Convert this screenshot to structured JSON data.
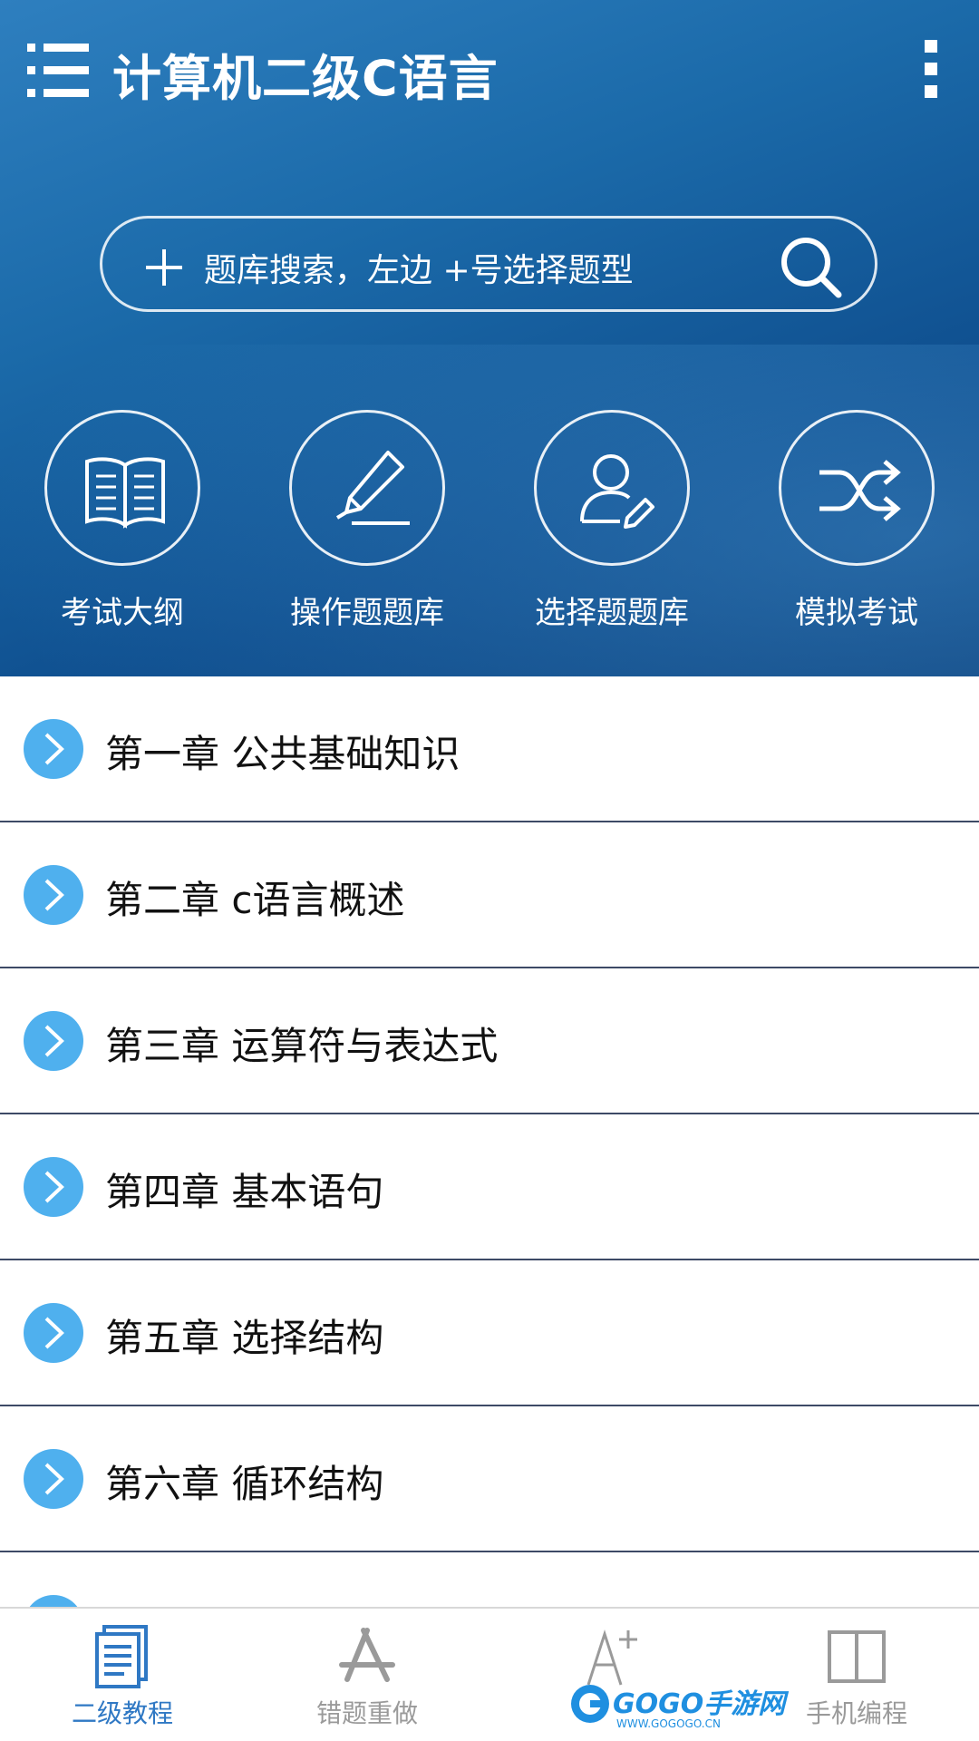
{
  "header": {
    "title": "计算机二级C语言",
    "menu_icon": "list-menu-icon",
    "more_icon": "more-vertical-icon"
  },
  "search": {
    "placeholder": "题库搜索，左边 +号选择题型",
    "plus_icon": "plus-icon",
    "search_icon": "search-icon"
  },
  "quick_actions": [
    {
      "label": "考试大纲",
      "icon": "book-icon"
    },
    {
      "label": "操作题题库",
      "icon": "pen-icon"
    },
    {
      "label": "选择题题库",
      "icon": "user-edit-icon"
    },
    {
      "label": "模拟考试",
      "icon": "shuffle-icon"
    }
  ],
  "chapters": [
    {
      "label": "第一章 公共基础知识"
    },
    {
      "label": "第二章  c语言概述"
    },
    {
      "label": "第三章  运算符与表达式"
    },
    {
      "label": "第四章  基本语句"
    },
    {
      "label": "第五章  选择结构"
    },
    {
      "label": "第六章  循环结构"
    }
  ],
  "bottom_nav": [
    {
      "label": "二级教程",
      "icon": "document-icon",
      "active": true
    },
    {
      "label": "错题重做",
      "icon": "app-store-icon",
      "active": false
    },
    {
      "label": "",
      "icon": "font-size-icon",
      "active": false
    },
    {
      "label": "手机编程",
      "icon": "open-book-icon",
      "active": false
    }
  ],
  "watermark": {
    "text": "GOGO手游网",
    "url": "WWW.GOGOGO.CN"
  },
  "colors": {
    "header_gradient_top": "#2e7fbf",
    "header_gradient_bottom": "#0a3f7a",
    "bullet": "#4fb0ee",
    "active_nav": "#2f78c4",
    "inactive_nav": "#9a9a9a",
    "divider": "#3d4a66"
  }
}
